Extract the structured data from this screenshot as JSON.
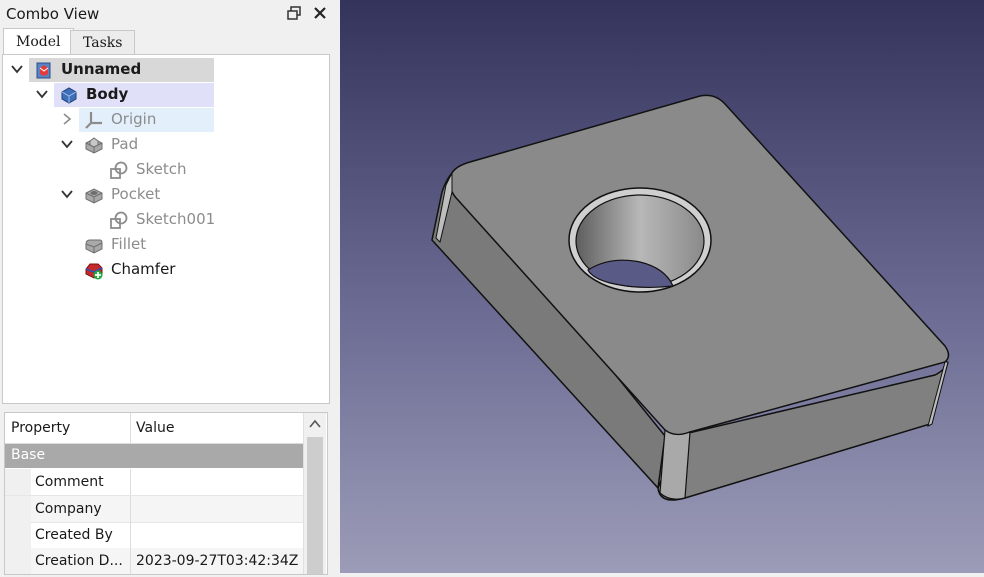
{
  "panel": {
    "title": "Combo View",
    "float_icon": "float-icon",
    "close_icon": "close-icon"
  },
  "tabs": [
    {
      "label": "Model",
      "active": true
    },
    {
      "label": "Tasks",
      "active": false
    }
  ],
  "tree": [
    {
      "label": "Unnamed",
      "icon": "document-icon",
      "expander": "expanded",
      "style": "bold"
    },
    {
      "label": "Body",
      "icon": "body-icon",
      "expander": "expanded",
      "style": "bold"
    },
    {
      "label": "Origin",
      "icon": "origin-icon",
      "expander": "collapsed",
      "style": "dim"
    },
    {
      "label": "Pad",
      "icon": "pad-icon",
      "expander": "expanded",
      "style": "dim"
    },
    {
      "label": "Sketch",
      "icon": "sketch-icon",
      "expander": "none",
      "style": "dim"
    },
    {
      "label": "Pocket",
      "icon": "pocket-icon",
      "expander": "expanded",
      "style": "dim"
    },
    {
      "label": "Sketch001",
      "icon": "sketch-icon",
      "expander": "none",
      "style": "dim"
    },
    {
      "label": "Fillet",
      "icon": "fillet-icon",
      "expander": "none",
      "style": "dim"
    },
    {
      "label": "Chamfer",
      "icon": "chamfer-icon",
      "expander": "none",
      "style": "normal"
    }
  ],
  "properties": {
    "col_property": "Property",
    "col_value": "Value",
    "group": "Base",
    "rows": [
      {
        "key": "Comment",
        "value": ""
      },
      {
        "key": "Company",
        "value": ""
      },
      {
        "key": "Created By",
        "value": ""
      },
      {
        "key": "Creation D...",
        "value": "2023-09-27T03:42:34Z"
      }
    ]
  },
  "colors": {
    "selection_highlight": "#d8d8d8",
    "body_highlight": "#e0e0f8",
    "origin_highlight": "#e3f0fb",
    "viewport_top": "#33335c",
    "viewport_bottom": "#9c9cb8",
    "model_face": "#8a8a8a"
  }
}
